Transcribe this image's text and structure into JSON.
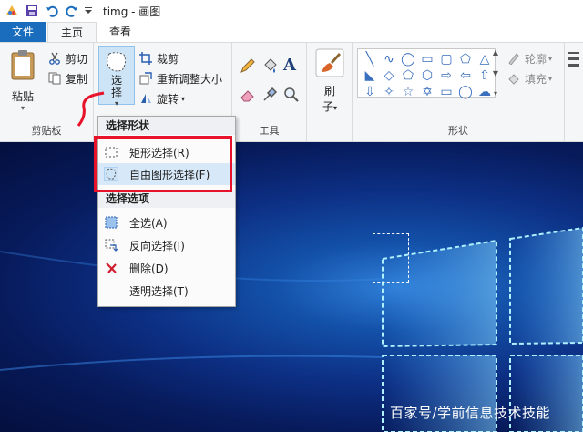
{
  "window": {
    "title": "timg - 画图"
  },
  "tabs": [
    {
      "label": "文件"
    },
    {
      "label": "主页"
    },
    {
      "label": "查看"
    }
  ],
  "clipboard": {
    "paste": "粘贴",
    "cut": "剪切",
    "copy": "复制",
    "label": "剪贴板"
  },
  "image_group": {
    "select_top": "选",
    "select_bottom": "择",
    "crop": "裁剪",
    "resize": "重新调整大小",
    "rotate": "旋转"
  },
  "tools": {
    "label": "工具"
  },
  "brush": {
    "top": "刷",
    "bottom": "子"
  },
  "shapes": {
    "label": "形状",
    "outline": "轮廓",
    "fill": "填充",
    "icons": [
      "╲",
      "∿",
      "◯",
      "▭",
      "▢",
      "⬠",
      "△",
      "◣",
      "◇",
      "⬠",
      "⬡",
      "⇨",
      "⇦",
      "⇧",
      "⇩",
      "✧",
      "☆",
      "✡",
      "▭",
      "◯",
      "☁"
    ]
  },
  "select_menu": {
    "section1": "选择形状",
    "rect_select": "矩形选择(R)",
    "free_select": "自由图形选择(F)",
    "section2": "选择选项",
    "select_all": "全选(A)",
    "invert": "反向选择(I)",
    "delete": "删除(D)",
    "transparent": "透明选择(T)"
  },
  "canvas": {
    "watermark": "百家号/学前信息技术技能"
  },
  "colors": {
    "file_tab": "#1a6dbd",
    "highlight": "#d7e8f8",
    "annotation": "#e8132a"
  }
}
